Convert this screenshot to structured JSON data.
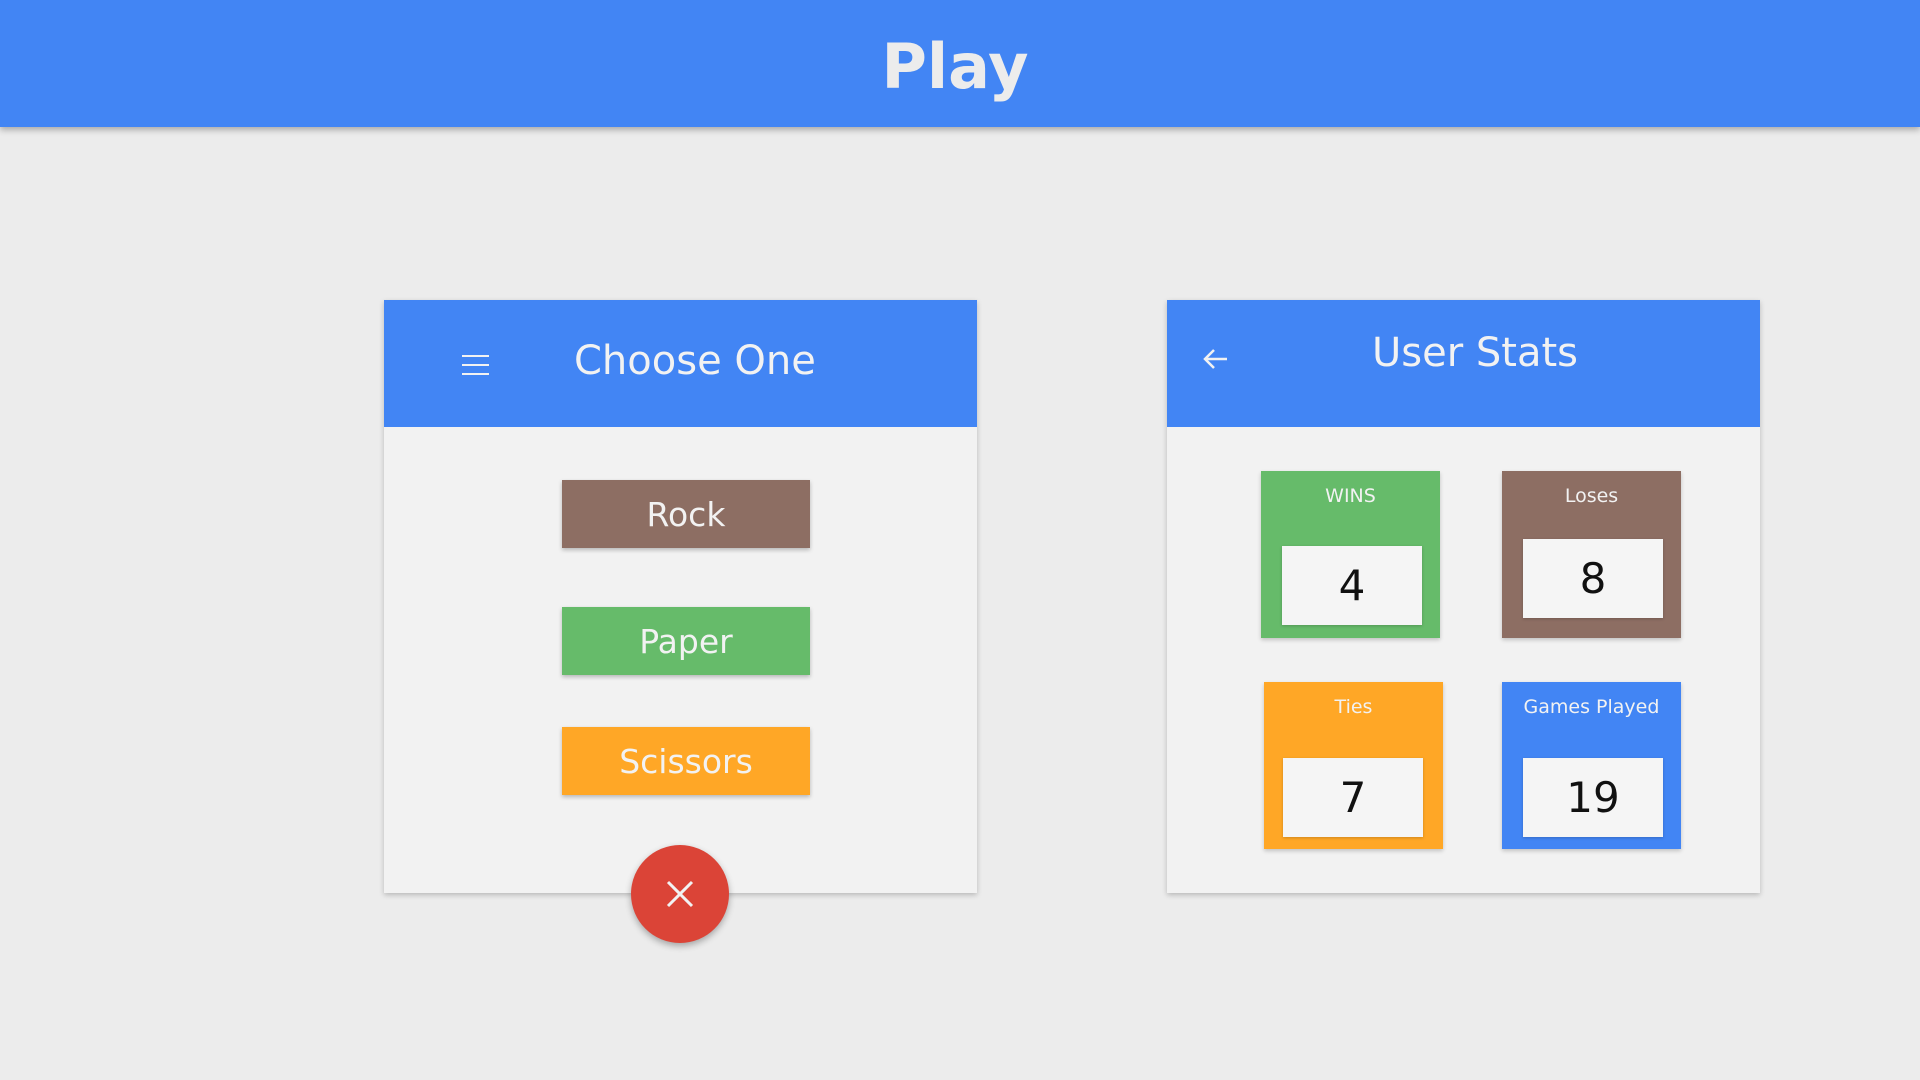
{
  "app": {
    "title": "Play"
  },
  "choose_card": {
    "title": "Choose One",
    "menu_icon": "hamburger-menu-icon",
    "choices": [
      {
        "label": "Rock",
        "color": "#8d6e63"
      },
      {
        "label": "Paper",
        "color": "#66bb6a"
      },
      {
        "label": "Scissors",
        "color": "#ffa726"
      }
    ],
    "fab_icon": "close-icon",
    "fab_color": "#db4437"
  },
  "stats_card": {
    "title": "User Stats",
    "back_icon": "arrow-left-icon",
    "stats": [
      {
        "label": "WINS",
        "value": "4",
        "color": "#66bb6a"
      },
      {
        "label": "Loses",
        "value": "8",
        "color": "#8d6e63"
      },
      {
        "label": "Ties",
        "value": "7",
        "color": "#ffa726"
      },
      {
        "label": "Games Played",
        "value": "19",
        "color": "#4285f4"
      }
    ]
  },
  "colors": {
    "primary": "#4285f4",
    "background": "#ececec",
    "card_background": "#f2f2f2"
  }
}
